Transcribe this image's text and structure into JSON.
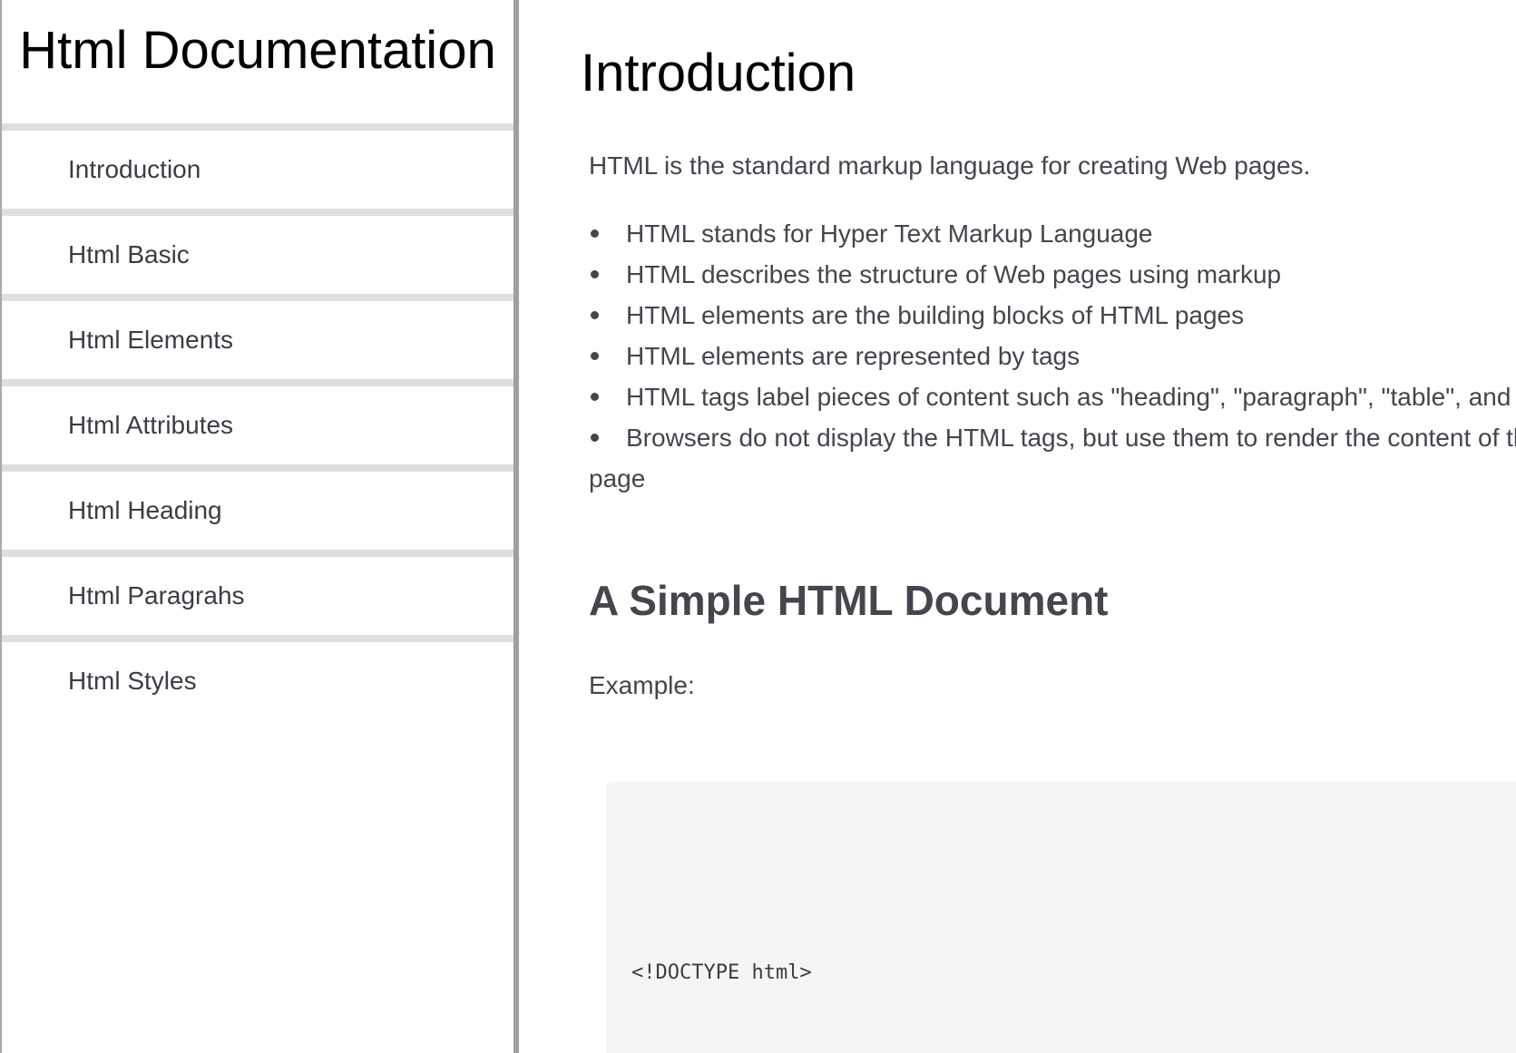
{
  "navbar": {
    "header": "Html Documentation",
    "items": [
      {
        "label": "Introduction"
      },
      {
        "label": "Html Basic"
      },
      {
        "label": "Html Elements"
      },
      {
        "label": "Html Attributes"
      },
      {
        "label": "Html Heading"
      },
      {
        "label": "Html Paragrahs"
      },
      {
        "label": "Html Styles"
      }
    ]
  },
  "main": {
    "section_title": "Introduction",
    "intro": "HTML is the standard markup language for creating Web pages.",
    "bullets": [
      "HTML stands for Hyper Text Markup Language",
      "HTML describes the structure of Web pages using markup",
      "HTML elements are the building blocks of HTML pages",
      "HTML elements are represented by tags",
      "HTML tags label pieces of content such as \"heading\", \"paragraph\", \"table\", and so on",
      "Browsers do not display the HTML tags, but use them to render the content of the page"
    ],
    "subheading": "A Simple HTML Document",
    "example_label": "Example:",
    "code_first_line": "<!DOCTYPE html>"
  }
}
